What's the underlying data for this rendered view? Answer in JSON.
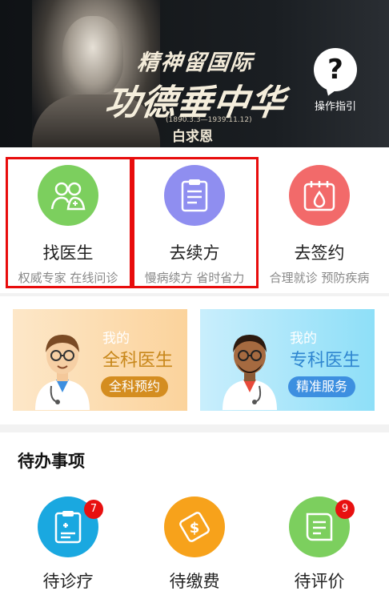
{
  "banner": {
    "slogan_line1": "精神留国际",
    "slogan_line2": "功德垂中华",
    "dates": "(1890.3.3—1939.11.12)",
    "name": "白求恩",
    "help_label": "操作指引",
    "help_icon": "?"
  },
  "quick_actions": [
    {
      "title": "找医生",
      "subtitle": "权威专家 在线问诊",
      "icon": "doctors-icon",
      "color": "#7ccf5e"
    },
    {
      "title": "去续方",
      "subtitle": "慢病续方 省时省力",
      "icon": "prescription-clipboard-icon",
      "color": "#8f8ef0"
    },
    {
      "title": "去签约",
      "subtitle": "合理就诊 预防疾病",
      "icon": "calendar-drop-icon",
      "color": "#f26a6a"
    }
  ],
  "doctor_cards": [
    {
      "my": "我的",
      "kind": "全科医生",
      "button": "全科预约"
    },
    {
      "my": "我的",
      "kind": "专科医生",
      "button": "精准服务"
    }
  ],
  "todo": {
    "heading": "待办事项",
    "items": [
      {
        "title": "待诊疗",
        "badge": "7",
        "icon": "medical-record-icon",
        "color": "#1aa8e0"
      },
      {
        "title": "待缴费",
        "badge": "",
        "icon": "payment-icon",
        "color": "#f7a21b"
      },
      {
        "title": "待评价",
        "badge": "9",
        "icon": "review-icon",
        "color": "#7ccf5e"
      }
    ]
  }
}
